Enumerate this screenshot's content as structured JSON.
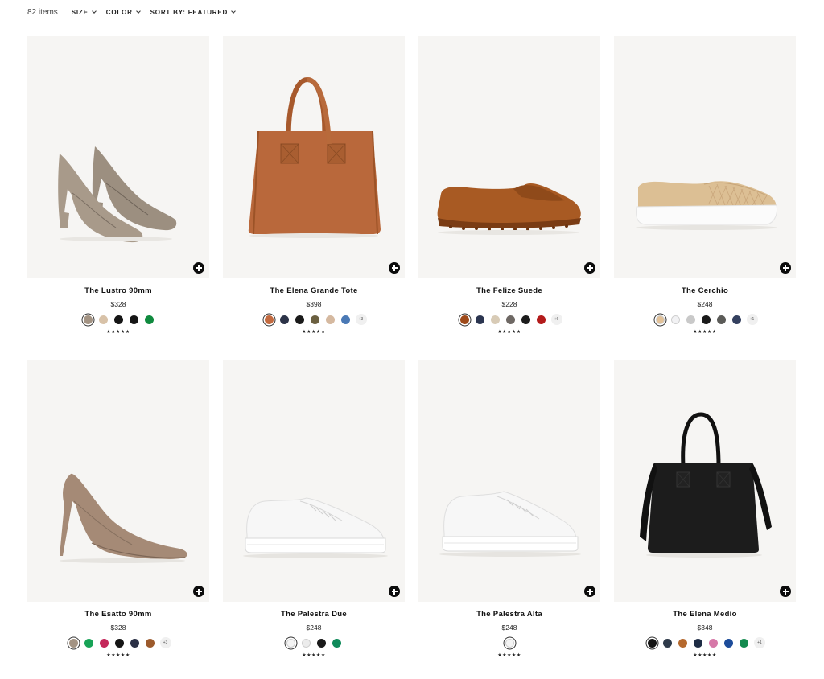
{
  "toolbar": {
    "item_count": "82 items",
    "filters": [
      {
        "label": "SIZE"
      },
      {
        "label": "COLOR"
      },
      {
        "label": "SORT BY: FEATURED"
      }
    ]
  },
  "products": [
    {
      "name": "The Lustro 90mm",
      "price": "$328",
      "rating": "★★★★★",
      "more": "",
      "swatches": [
        "#a39383",
        "#d8c2a8",
        "#151515",
        "#151515",
        "#0f8a3e"
      ]
    },
    {
      "name": "The Elena Grande Tote",
      "price": "$398",
      "rating": "★★★★★",
      "more": "+3",
      "swatches": [
        "#c36a3f",
        "#2c3348",
        "#1a1a1a",
        "#6b6040",
        "#d5b9a0",
        "#4a79b5"
      ]
    },
    {
      "name": "The Felize Suede",
      "price": "$228",
      "rating": "★★★★★",
      "more": "+6",
      "swatches": [
        "#9e4a1a",
        "#2b3550",
        "#d8cbb6",
        "#6e6864",
        "#1c1c1c",
        "#b31b1b"
      ]
    },
    {
      "name": "The Cerchio",
      "price": "$248",
      "rating": "★★★★★",
      "more": "+1",
      "swatches": [
        "#e2c198",
        "#f2f2f4",
        "#c9c9c9",
        "#1a1a1a",
        "#5b5b58",
        "#34405f"
      ]
    },
    {
      "name": "The Esatto 90mm",
      "price": "$328",
      "rating": "★★★★★",
      "more": "+3",
      "swatches": [
        "#a39383",
        "#17a356",
        "#c4275a",
        "#151515",
        "#2a3045",
        "#9c5a2c"
      ]
    },
    {
      "name": "The Palestra Due",
      "price": "$248",
      "rating": "★★★★★",
      "more": "",
      "swatches": [
        "#f4f4f4",
        "#ececec",
        "#1a1a1a",
        "#0f8a5a"
      ]
    },
    {
      "name": "The Palestra Alta",
      "price": "$248",
      "rating": "★★★★★",
      "more": "",
      "swatches": [
        "#f4f4f4"
      ]
    },
    {
      "name": "The Elena Medio",
      "price": "$348",
      "rating": "★★★★★",
      "more": "+1",
      "swatches": [
        "#151515",
        "#2e3a4a",
        "#b5692e",
        "#1e2c45",
        "#d678a8",
        "#1d4c9a",
        "#138a4e"
      ]
    }
  ]
}
